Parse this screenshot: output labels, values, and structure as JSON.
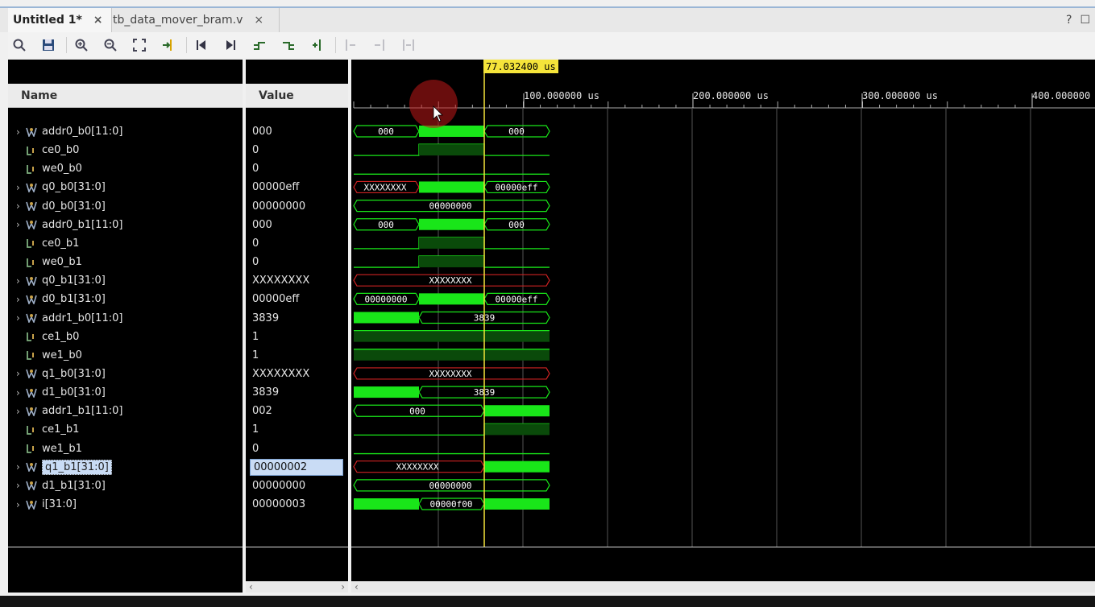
{
  "tabs": [
    {
      "label": "Untitled 1*",
      "active": true
    },
    {
      "label": "tb_data_mover_bram.v",
      "active": false
    }
  ],
  "window_buttons": {
    "help": "?",
    "maximize": "☐"
  },
  "toolbar_icons": [
    "search-icon",
    "save-icon",
    "zoom-in-icon",
    "zoom-out-icon",
    "zoom-fit-icon",
    "go-to-cursor-icon",
    "go-to-start-icon",
    "go-to-end-icon",
    "previous-transition-icon",
    "next-transition-icon",
    "add-marker-icon",
    "previous-marker-icon",
    "next-marker-icon",
    "swap-cursors-icon"
  ],
  "columns": {
    "name": "Name",
    "value": "Value"
  },
  "cursor": {
    "label": "77.032400 us"
  },
  "time_axis": [
    "100.000000 us",
    "200.000000 us",
    "300.000000 us",
    "400.000000"
  ],
  "signals": [
    {
      "name": "addr0_b0[11:0]",
      "value": "000",
      "bus": true
    },
    {
      "name": "ce0_b0",
      "value": "0",
      "bus": false
    },
    {
      "name": "we0_b0",
      "value": "0",
      "bus": false
    },
    {
      "name": "q0_b0[31:0]",
      "value": "00000eff",
      "bus": true
    },
    {
      "name": "d0_b0[31:0]",
      "value": "00000000",
      "bus": true
    },
    {
      "name": "addr0_b1[11:0]",
      "value": "000",
      "bus": true
    },
    {
      "name": "ce0_b1",
      "value": "0",
      "bus": false
    },
    {
      "name": "we0_b1",
      "value": "0",
      "bus": false
    },
    {
      "name": "q0_b1[31:0]",
      "value": "XXXXXXXX",
      "bus": true
    },
    {
      "name": "d0_b1[31:0]",
      "value": "00000eff",
      "bus": true
    },
    {
      "name": "addr1_b0[11:0]",
      "value": "3839",
      "bus": true
    },
    {
      "name": "ce1_b0",
      "value": "1",
      "bus": false
    },
    {
      "name": "we1_b0",
      "value": "1",
      "bus": false
    },
    {
      "name": "q1_b0[31:0]",
      "value": "XXXXXXXX",
      "bus": true
    },
    {
      "name": "d1_b0[31:0]",
      "value": "3839",
      "bus": true
    },
    {
      "name": "addr1_b1[11:0]",
      "value": "002",
      "bus": true
    },
    {
      "name": "ce1_b1",
      "value": "1",
      "bus": false
    },
    {
      "name": "we1_b1",
      "value": "0",
      "bus": false
    },
    {
      "name": "q1_b1[31:0]",
      "value": "00000002",
      "bus": true,
      "selected": true
    },
    {
      "name": "d1_b1[31:0]",
      "value": "00000000",
      "bus": true
    },
    {
      "name": "i[31:0]",
      "value": "00000003",
      "bus": true
    }
  ],
  "wave_labels": {
    "addr0_b0_a": "000",
    "addr0_b0_b": "000",
    "q0_b0_a": "XXXXXXXX",
    "q0_b0_b": "00000eff",
    "d0_b0": "00000000",
    "addr0_b1_a": "000",
    "addr0_b1_b": "000",
    "q0_b1": "XXXXXXXX",
    "d0_b1_a": "00000000",
    "d0_b1_b": "00000eff",
    "addr1_b0": "3839",
    "q1_b0": "XXXXXXXX",
    "d1_b0": "3839",
    "addr1_b1": "000",
    "q1_b1": "XXXXXXXX",
    "d1_b1": "00000000",
    "i": "00000f00"
  },
  "colors": {
    "green": "#19e619",
    "dark_green": "#0a4a0a",
    "red": "#cc2222",
    "cursor": "#f5e43a",
    "background": "#000000"
  }
}
